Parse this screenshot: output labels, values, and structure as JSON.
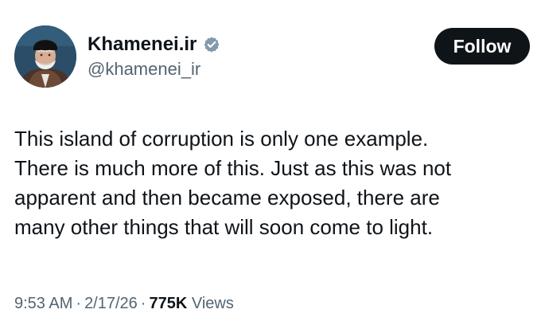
{
  "author": {
    "display_name": "Khamenei.ir",
    "handle": "@khamenei_ir",
    "avatar_icon": "portrait-avatar",
    "verified_icon": "verified-badge-icon",
    "verified_color": "#829AAB"
  },
  "actions": {
    "follow_label": "Follow"
  },
  "tweet": {
    "lines": [
      "This island of corruption is only one example.",
      "There is much more of this. Just as this was not",
      "apparent and then became exposed, there are",
      "many other things that will soon come to light."
    ]
  },
  "meta": {
    "time": "9:53 AM",
    "separator": "·",
    "date": "2/17/26",
    "views_count": "775K",
    "views_label": "Views"
  },
  "colors": {
    "text_primary": "#0F1419",
    "text_secondary": "#536471",
    "button_background": "#0F1419",
    "button_text": "#FFFFFF",
    "background": "#FFFFFF"
  }
}
